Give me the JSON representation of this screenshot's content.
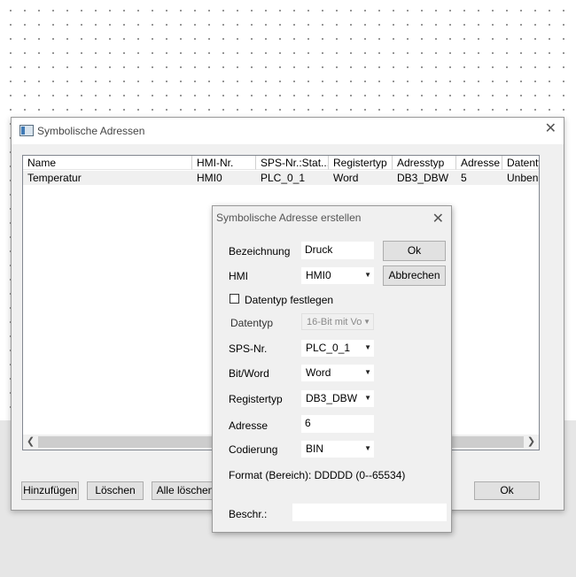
{
  "window": {
    "title": "Symbolische Adressen"
  },
  "table": {
    "columns": [
      "Name",
      "HMI-Nr.",
      "SPS-Nr.:Stat...",
      "Registertyp",
      "Adresstyp",
      "Adresse",
      "Datenty"
    ],
    "rows": [
      [
        "Temperatur",
        "HMI0",
        "PLC_0_1",
        "Word",
        "DB3_DBW",
        "5",
        "Unbenu"
      ]
    ]
  },
  "buttons": {
    "add": "Hinzufügen",
    "delete": "Löschen",
    "delete_all": "Alle löschen",
    "ok": "Ok"
  },
  "dialog": {
    "title": "Symbolische Adresse erstellen",
    "ok": "Ok",
    "cancel": "Abbrechen",
    "labels": {
      "bezeichnung": "Bezeichnung",
      "hmi": "HMI",
      "datentyp_festlegen": "Datentyp festlegen",
      "datentyp": "Datentyp",
      "sps": "SPS-Nr.",
      "bitword": "Bit/Word",
      "registertyp": "Registertyp",
      "adresse": "Adresse",
      "codierung": "Codierung",
      "beschr": "Beschr.:"
    },
    "values": {
      "bezeichnung": "Druck",
      "hmi": "HMI0",
      "datentyp_checked": false,
      "datentyp": "16-Bit mit Vo",
      "sps": "PLC_0_1",
      "bitword": "Word",
      "registertyp": "DB3_DBW",
      "adresse": "6",
      "codierung": "BIN",
      "beschr": ""
    },
    "format_text": "Format (Bereich): DDDDD (0--65534)"
  },
  "icons": {
    "app": "window-app-icon",
    "close": "close-icon",
    "dropdown": "chevron-down-icon"
  }
}
